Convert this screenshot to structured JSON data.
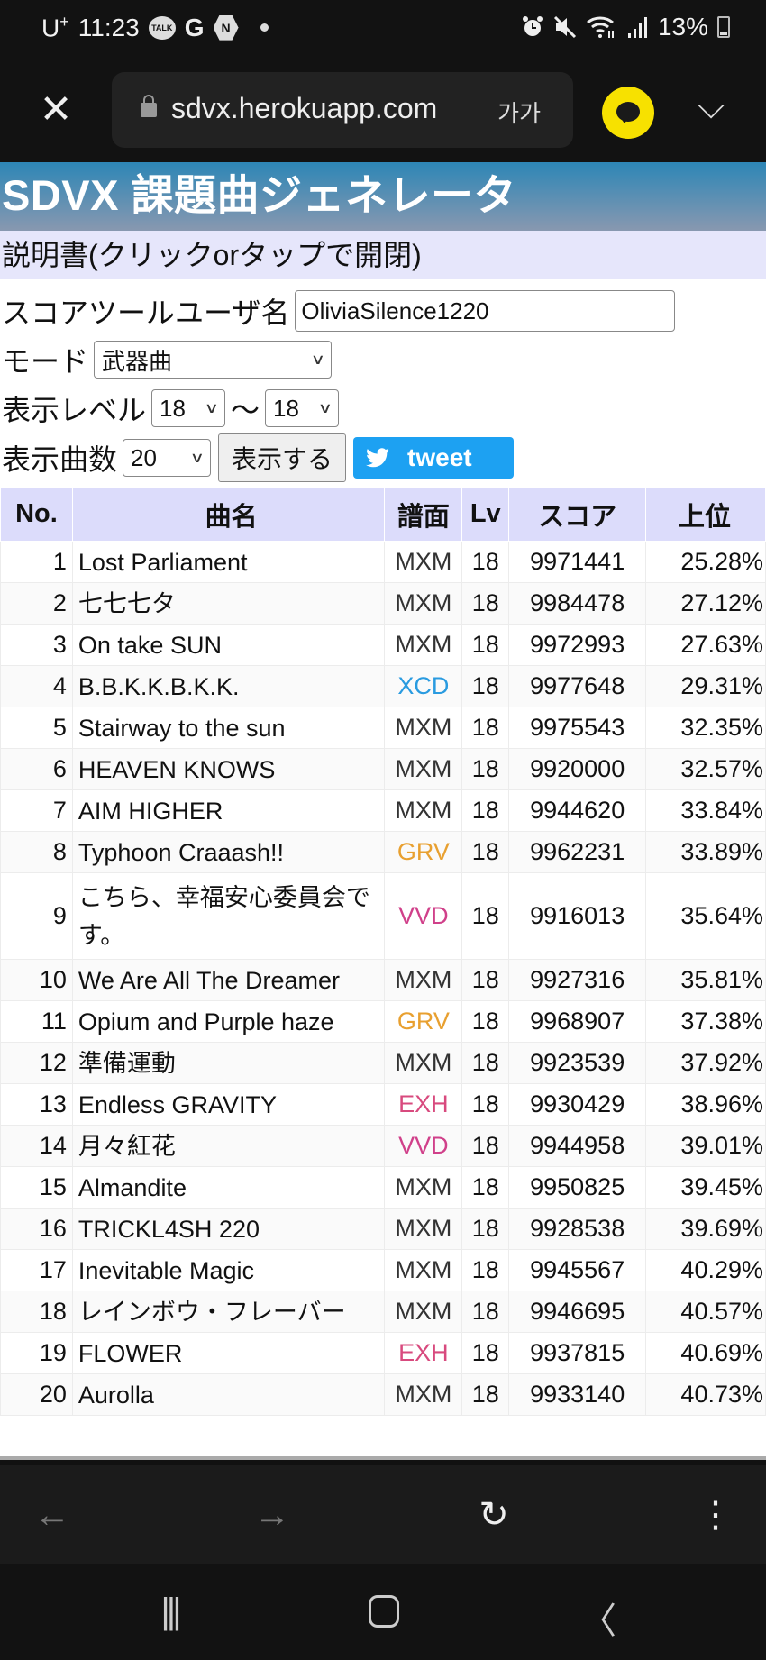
{
  "status_bar": {
    "carrier": "U",
    "carrier_sup": "+",
    "time": "11:23",
    "notification_icons": [
      "kakaotalk-icon",
      "google-icon",
      "naver-icon",
      "dot-icon"
    ],
    "talk_label": "TALK",
    "g_label": "G",
    "n_label": "N",
    "system_icons": [
      "alarm-icon",
      "mute-icon",
      "wifi-icon",
      "signal-icon"
    ],
    "battery": "13%"
  },
  "browser": {
    "url": "sdvx.herokuapp.com",
    "text_size_label": "가가",
    "close_glyph": "✕",
    "expand_glyph": "⌵"
  },
  "page": {
    "title": "SDVX 課題曲ジェネレータ",
    "manual_toggle": "説明書(クリックorタップで開閉)",
    "form": {
      "username_label": "スコアツールユーザ名",
      "username_value": "OliviaSilence1220",
      "mode_label": "モード",
      "mode_value": "武器曲",
      "level_label": "表示レベル",
      "level_from": "18",
      "level_sep": "〜",
      "level_to": "18",
      "count_label": "表示曲数",
      "count_value": "20",
      "show_button": "表示する",
      "tweet_button": "tweet"
    },
    "table": {
      "headers": [
        "No.",
        "曲名",
        "譜面",
        "Lv",
        "スコア",
        "上位"
      ],
      "rows": [
        {
          "no": "1",
          "name": "Lost Parliament",
          "chart": "MXM",
          "lv": "18",
          "score": "9971441",
          "rank": "25.28%"
        },
        {
          "no": "2",
          "name": "七七七タ",
          "chart": "MXM",
          "lv": "18",
          "score": "9984478",
          "rank": "27.12%"
        },
        {
          "no": "3",
          "name": "On take SUN",
          "chart": "MXM",
          "lv": "18",
          "score": "9972993",
          "rank": "27.63%"
        },
        {
          "no": "4",
          "name": "B.B.K.K.B.K.K.",
          "chart": "XCD",
          "lv": "18",
          "score": "9977648",
          "rank": "29.31%"
        },
        {
          "no": "5",
          "name": "Stairway to the sun",
          "chart": "MXM",
          "lv": "18",
          "score": "9975543",
          "rank": "32.35%"
        },
        {
          "no": "6",
          "name": "HEAVEN KNOWS",
          "chart": "MXM",
          "lv": "18",
          "score": "9920000",
          "rank": "32.57%"
        },
        {
          "no": "7",
          "name": "AIM HIGHER",
          "chart": "MXM",
          "lv": "18",
          "score": "9944620",
          "rank": "33.84%"
        },
        {
          "no": "8",
          "name": "Typhoon Craaash!!",
          "chart": "GRV",
          "lv": "18",
          "score": "9962231",
          "rank": "33.89%"
        },
        {
          "no": "9",
          "name": "こちら、幸福安心委員会です。",
          "chart": "VVD",
          "lv": "18",
          "score": "9916013",
          "rank": "35.64%"
        },
        {
          "no": "10",
          "name": "We Are All The Dreamer",
          "chart": "MXM",
          "lv": "18",
          "score": "9927316",
          "rank": "35.81%"
        },
        {
          "no": "11",
          "name": "Opium and Purple haze",
          "chart": "GRV",
          "lv": "18",
          "score": "9968907",
          "rank": "37.38%"
        },
        {
          "no": "12",
          "name": "準備運動",
          "chart": "MXM",
          "lv": "18",
          "score": "9923539",
          "rank": "37.92%"
        },
        {
          "no": "13",
          "name": "Endless GRAVITY",
          "chart": "EXH",
          "lv": "18",
          "score": "9930429",
          "rank": "38.96%"
        },
        {
          "no": "14",
          "name": "月々紅花",
          "chart": "VVD",
          "lv": "18",
          "score": "9944958",
          "rank": "39.01%"
        },
        {
          "no": "15",
          "name": "Almandite",
          "chart": "MXM",
          "lv": "18",
          "score": "9950825",
          "rank": "39.45%"
        },
        {
          "no": "16",
          "name": "TRICKL4SH 220",
          "chart": "MXM",
          "lv": "18",
          "score": "9928538",
          "rank": "39.69%"
        },
        {
          "no": "17",
          "name": "Inevitable Magic",
          "chart": "MXM",
          "lv": "18",
          "score": "9945567",
          "rank": "40.29%"
        },
        {
          "no": "18",
          "name": "レインボウ・フレーバー",
          "chart": "MXM",
          "lv": "18",
          "score": "9946695",
          "rank": "40.57%"
        },
        {
          "no": "19",
          "name": "FLOWER",
          "chart": "EXH",
          "lv": "18",
          "score": "9937815",
          "rank": "40.69%"
        },
        {
          "no": "20",
          "name": "Aurolla",
          "chart": "MXM",
          "lv": "18",
          "score": "9933140",
          "rank": "40.73%"
        }
      ]
    },
    "chart_colors": {
      "MXM": "#333333",
      "XCD": "#2a9be0",
      "GRV": "#e8a030",
      "VVD": "#d0408a",
      "EXH": "#d84a7e"
    }
  },
  "browser_nav": {
    "back": "←",
    "forward": "→",
    "reload": "↻",
    "menu": "⋮"
  },
  "system_nav": {
    "recents": "|||",
    "back": "〈"
  }
}
